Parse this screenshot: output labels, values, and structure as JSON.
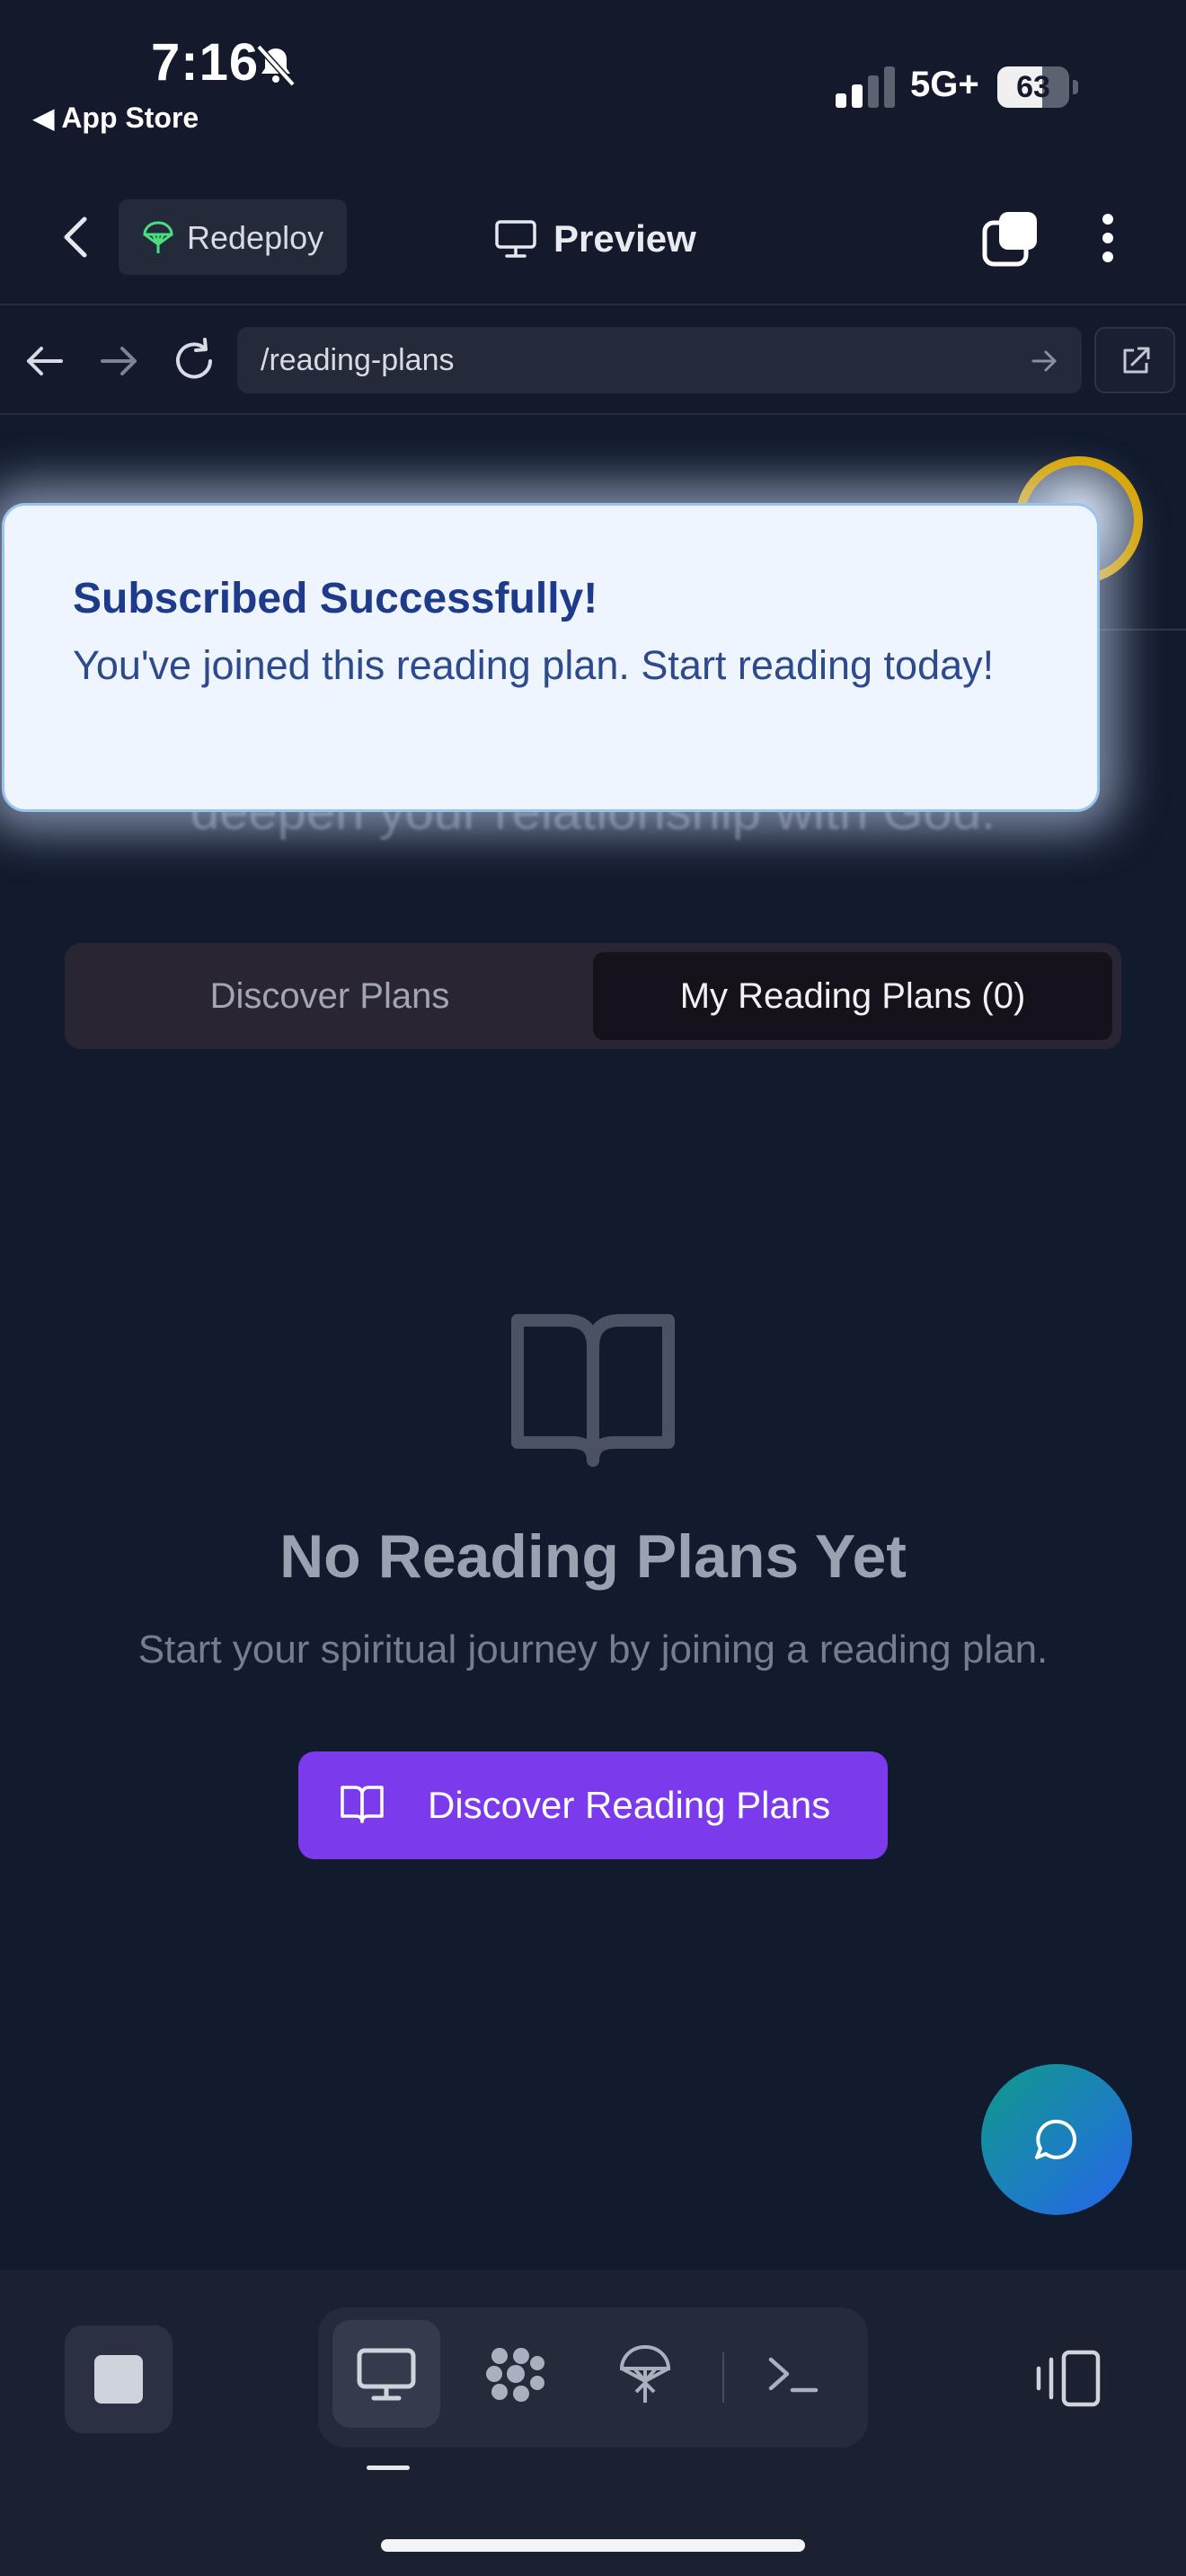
{
  "status": {
    "time": "7:16",
    "back_app": "◀ App Store",
    "network": "5G+",
    "battery": "63",
    "battery_level": 0.63
  },
  "header": {
    "redeploy_label": "Redeploy",
    "title": "Preview"
  },
  "urlbar": {
    "url": "/reading-plans"
  },
  "page": {
    "subtitle_partial": "deepen your relationship with God.",
    "tabs": [
      {
        "label": "Discover Plans",
        "selected": false
      },
      {
        "label": "My Reading Plans (0)",
        "selected": true
      }
    ],
    "empty": {
      "title": "No Reading Plans Yet",
      "description": "Start your spiritual journey by joining a reading plan.",
      "button_label": "Discover Reading Plans"
    }
  },
  "toast": {
    "title": "Subscribed Successfully!",
    "description": "You've joined this reading plan. Start reading today!"
  },
  "bottombar": {
    "tools": [
      {
        "icon": "monitor-icon",
        "active": true
      },
      {
        "icon": "agents-icon",
        "active": false
      },
      {
        "icon": "deploy-icon",
        "active": false
      },
      {
        "icon": "terminal-icon",
        "active": false
      }
    ]
  },
  "colors": {
    "background": "#121a2e",
    "accent_button": "#7c3aed",
    "toast_bg": "#eef5ff",
    "toast_title": "#1e3a8a",
    "avatar_ring": "#d9a400"
  }
}
